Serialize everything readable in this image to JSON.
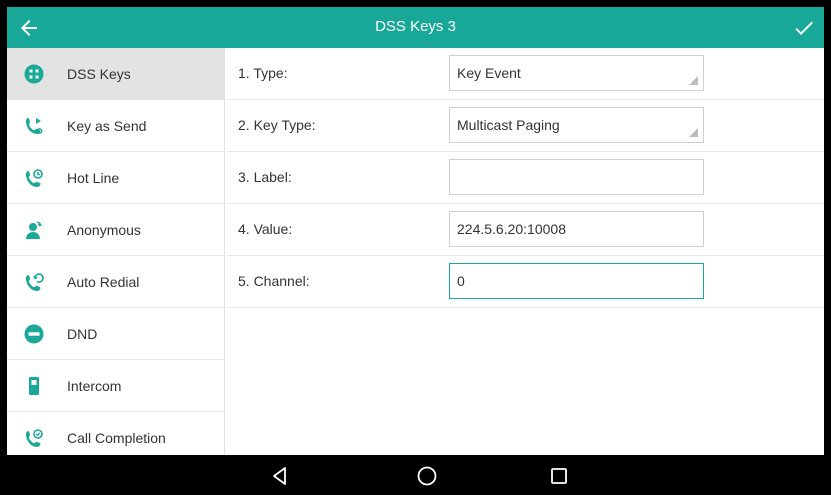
{
  "header": {
    "title": "DSS Keys 3"
  },
  "colors": {
    "accent": "#17a898",
    "icon": "#1aa898"
  },
  "sidebar": {
    "items": [
      {
        "label": "DSS Keys",
        "icon": "grid-circle-icon",
        "active": true
      },
      {
        "label": "Key as Send",
        "icon": "phone-send-icon"
      },
      {
        "label": "Hot Line",
        "icon": "phone-hotline-icon"
      },
      {
        "label": "Anonymous",
        "icon": "anonymous-user-icon"
      },
      {
        "label": "Auto Redial",
        "icon": "phone-redial-icon"
      },
      {
        "label": "DND",
        "icon": "dnd-icon"
      },
      {
        "label": "Intercom",
        "icon": "intercom-icon"
      },
      {
        "label": "Call Completion",
        "icon": "call-completion-icon"
      }
    ]
  },
  "form": {
    "type": {
      "label": "1. Type:",
      "value": "Key Event"
    },
    "key_type": {
      "label": "2. Key Type:",
      "value": "Multicast Paging"
    },
    "label": {
      "label": "3. Label:",
      "value": ""
    },
    "value": {
      "label": "4. Value:",
      "value": "224.5.6.20:10008"
    },
    "channel": {
      "label": "5. Channel:",
      "value": "0"
    }
  },
  "navbar": {
    "buttons": [
      "back-triangle-icon",
      "home-circle-icon",
      "recents-square-icon"
    ]
  }
}
